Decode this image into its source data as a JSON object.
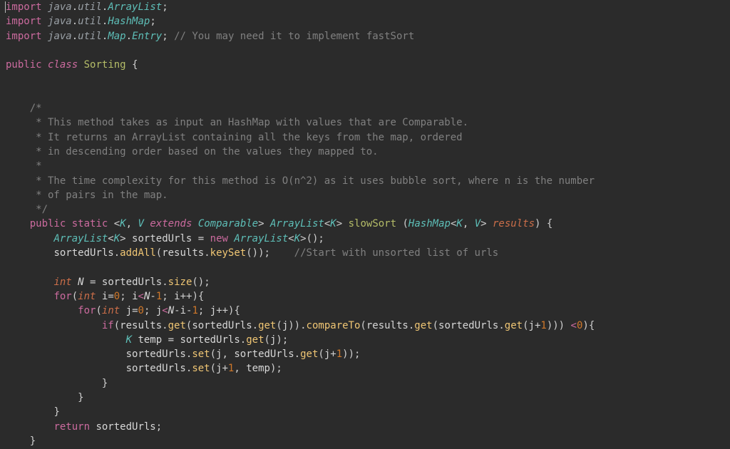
{
  "imports": {
    "kw": "import",
    "pkg1": "java",
    "pkg2": "util",
    "cls_arraylist": "ArrayList",
    "cls_hashmap": "HashMap",
    "cls_map": "Map",
    "cls_entry": "Entry",
    "comment": "// You may need it to implement fastSort"
  },
  "classdecl": {
    "public": "public",
    "class": "class",
    "name": "Sorting",
    "brace": "{"
  },
  "doc": {
    "l0": "/*",
    "l1": " * This method takes as input an HashMap with values that are Comparable.",
    "l2": " * It returns an ArrayList containing all the keys from the map, ordered",
    "l3": " * in descending order based on the values they mapped to.",
    "l4": " *",
    "l5": " * The time complexity for this method is O(n^2) as it uses bubble sort, where n is the number",
    "l6": " * of pairs in the map.",
    "l7": " */"
  },
  "sig": {
    "public": "public",
    "static": "static",
    "lt": "<",
    "K": "K",
    "comma": ",",
    "V": "V",
    "extends": "extends",
    "Comparable": "Comparable",
    "gt": ">",
    "ArrayList": "ArrayList",
    "method": "slowSort",
    "HashMap": "HashMap",
    "param": "results",
    "brace": "{"
  },
  "body": {
    "ArrayList": "ArrayList",
    "K": "K",
    "sortedUrls": "sortedUrls",
    "eq": "=",
    "new": "new",
    "addAll": "addAll",
    "results": "results",
    "keySet": "keySet",
    "comment_start": "//Start with unsorted list of urls",
    "int": "int",
    "N": "N",
    "size": "size",
    "for": "for",
    "i": "i",
    "zero": "0",
    "Nminus1": "N",
    "minus": "-",
    "one": "1",
    "ipp": "i",
    "j": "j",
    "if": "if",
    "get": "get",
    "compareTo": "compareTo",
    "jp1": "j",
    "plus": "+",
    "lt0": "<",
    "temp": "temp",
    "set": "set",
    "return": "return"
  }
}
